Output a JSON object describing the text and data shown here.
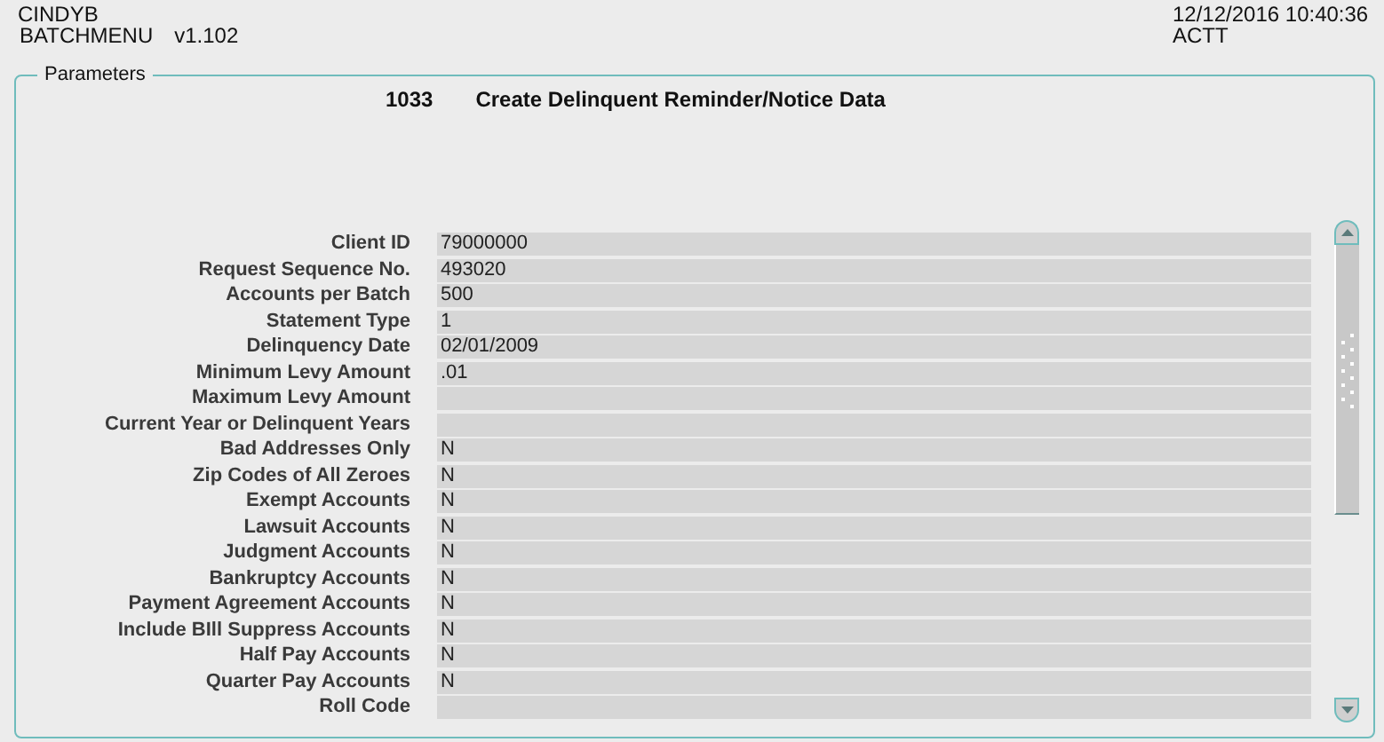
{
  "header": {
    "user": "CINDYB",
    "program": "BATCHMENU",
    "version": "v1.102",
    "datetime": "12/12/2016 10:40:36",
    "region": "ACTT"
  },
  "panel": {
    "legend": "Parameters",
    "job_number": "1033",
    "job_title": "Create Delinquent Reminder/Notice Data"
  },
  "fields": [
    {
      "label": "Client ID",
      "value": "79000000"
    },
    {
      "label": "Request Sequence No.",
      "value": "493020"
    },
    {
      "label": "Accounts per Batch",
      "value": "500"
    },
    {
      "label": "Statement Type",
      "value": "1"
    },
    {
      "label": "Delinquency Date",
      "value": "02/01/2009"
    },
    {
      "label": "Minimum Levy Amount",
      "value": ".01"
    },
    {
      "label": "Maximum Levy Amount"
    },
    {
      "label": "Current Year or Delinquent Years"
    },
    {
      "label": "Bad Addresses Only",
      "value": "N"
    },
    {
      "label": "Zip Codes of All Zeroes",
      "value": "N"
    },
    {
      "label": "Exempt Accounts",
      "value": "N"
    },
    {
      "label": "Lawsuit Accounts",
      "value": "N"
    },
    {
      "label": "Judgment Accounts",
      "value": "N"
    },
    {
      "label": "Bankruptcy Accounts",
      "value": "N"
    },
    {
      "label": "Payment Agreement Accounts",
      "value": "N"
    },
    {
      "label": "Include BIll Suppress Accounts",
      "value": "N"
    },
    {
      "label": "Half Pay Accounts",
      "value": "N"
    },
    {
      "label": "Quarter Pay Accounts",
      "value": "N"
    },
    {
      "label": "Roll Code"
    }
  ]
}
